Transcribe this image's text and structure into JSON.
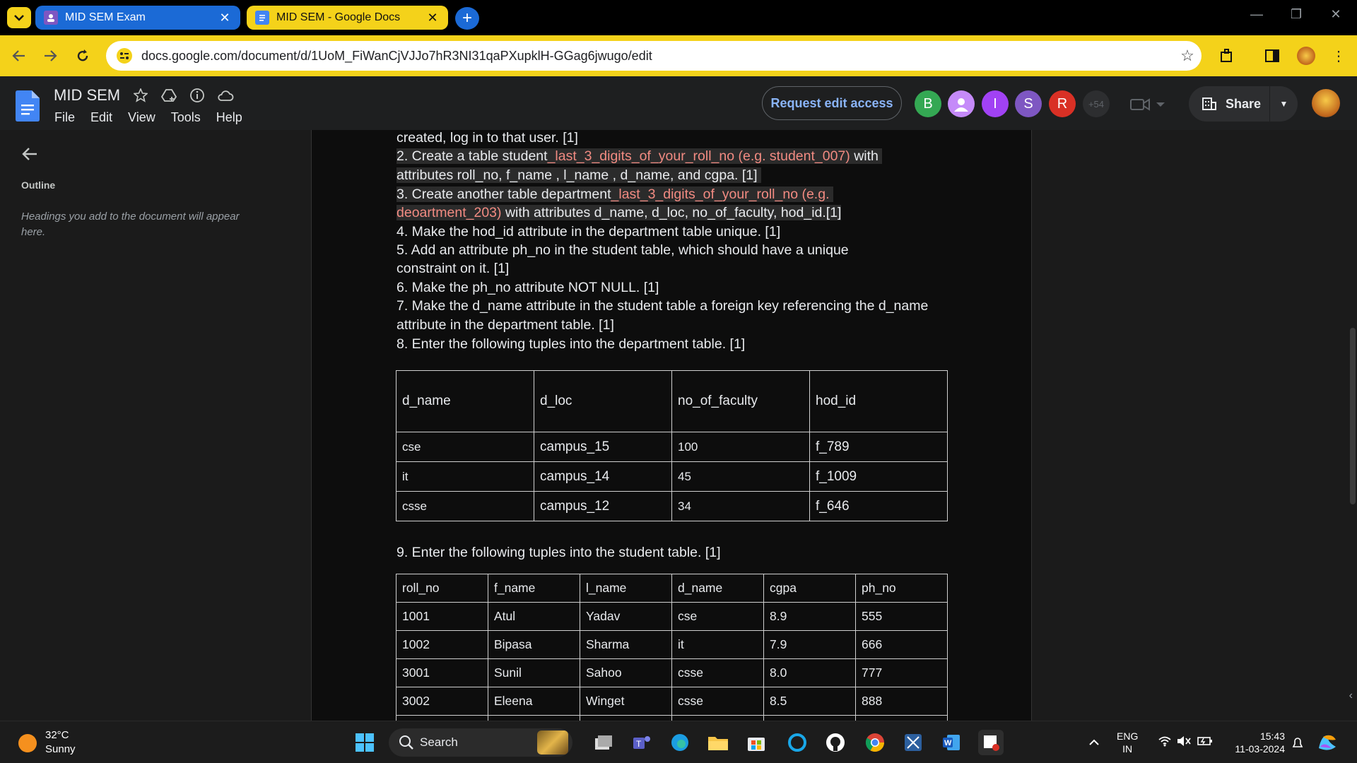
{
  "browser": {
    "tabs": [
      {
        "title": "MID SEM Exam",
        "close": "✕"
      },
      {
        "title": "MID SEM - Google Docs",
        "close": "✕"
      }
    ],
    "new_tab": "+",
    "url": "docs.google.com/document/d/1UoM_FiWanCjVJJo7hR3NI31qaPXupklH-GGag6jwugo/edit",
    "window_controls": [
      "—",
      "❐",
      "✕"
    ]
  },
  "docs": {
    "title": "MID SEM",
    "menus": [
      "File",
      "Edit",
      "View",
      "Tools",
      "Help"
    ],
    "request_edit": "Request edit access",
    "avatars": [
      {
        "letter": "B",
        "color": "#34a853"
      },
      {
        "letter": "",
        "color": "#c58af9"
      },
      {
        "letter": "I",
        "color": "#a142f4"
      },
      {
        "letter": "S",
        "color": "#7e57c2"
      },
      {
        "letter": "R",
        "color": "#d93025"
      }
    ],
    "more_count": "+54",
    "share": "Share"
  },
  "sidebar": {
    "outline_heading": "Outline",
    "outline_placeholder": "Headings you add to the document will appear here."
  },
  "document": {
    "lines": {
      "l1": "created, log in to that user. [1]",
      "l2a": "2. Create a table student",
      "l2b": "_last_3_digits_of_your_roll_no (e.g. student_007)",
      "l2c": " with",
      "l3": "attributes roll_no, f_name , l_name , d_name, and cgpa. [1]",
      "l4a": "3. Create another table department",
      "l4b": "_last_3_digits_of_your_roll_no  (e.g.",
      "l5a": "deoartment_203)",
      "l5b": " with attributes d_name, d_loc, no_of_faculty, hod_id.[1]",
      "l6": "4. Make the hod_id attribute in the department table unique. [1]",
      "l7": "5. Add an attribute ph_no in the student table, which should have a unique",
      "l8": "constraint on it. [1]",
      "l9": "6. Make the ph_no attribute NOT NULL. [1]",
      "l10": "7. Make the d_name attribute in the student table a foreign key referencing the d_name",
      "l11": "attribute in the department table. [1]",
      "l12": "8. Enter the following tuples into the department table. [1]",
      "l13": "9. Enter the following tuples into the student table. [1]"
    },
    "dept_table": {
      "headers": [
        "d_name",
        "d_loc",
        "no_of_faculty",
        "hod_id"
      ],
      "rows": [
        [
          "cse",
          "campus_15",
          "100",
          "f_789"
        ],
        [
          "it",
          "campus_14",
          "45",
          "f_1009"
        ],
        [
          "csse",
          "campus_12",
          "34",
          "f_646"
        ]
      ]
    },
    "student_table": {
      "headers": [
        "roll_no",
        "f_name",
        "l_name",
        "d_name",
        "cgpa",
        "ph_no"
      ],
      "rows": [
        [
          "1001",
          "Atul",
          "Yadav",
          "cse",
          "8.9",
          "555"
        ],
        [
          "1002",
          "Bipasa",
          "Sharma",
          "it",
          "7.9",
          "666"
        ],
        [
          "3001",
          "Sunil",
          "Sahoo",
          "csse",
          "8.0",
          "777"
        ],
        [
          "3002",
          "Eleena",
          "Winget",
          "csse",
          "8.5",
          "888"
        ]
      ]
    }
  },
  "taskbar": {
    "temperature": "32°C",
    "condition": "Sunny",
    "search": "Search",
    "lang1": "ENG",
    "lang2": "IN",
    "time": "15:43",
    "date": "11-03-2024"
  }
}
